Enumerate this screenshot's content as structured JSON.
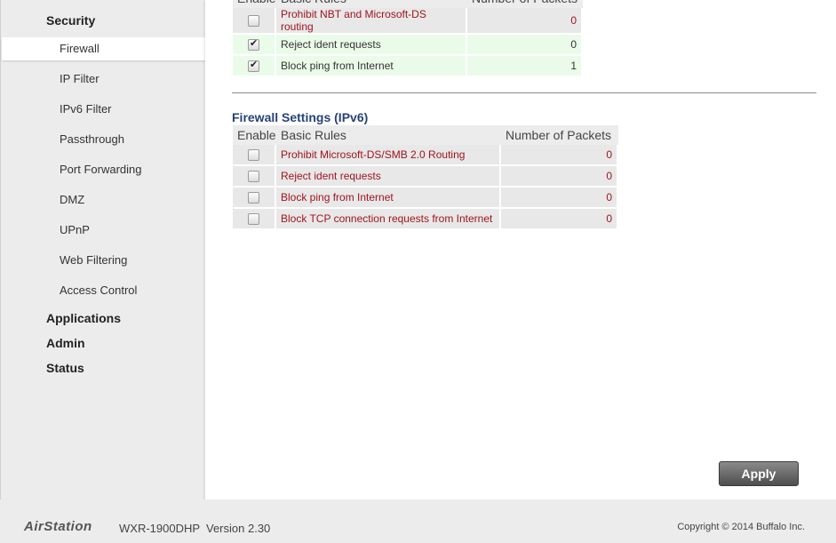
{
  "sidebar": {
    "category_security": "Security",
    "items": [
      {
        "label": "Firewall",
        "active": true
      },
      {
        "label": "IP Filter"
      },
      {
        "label": "IPv6 Filter"
      },
      {
        "label": "Passthrough"
      },
      {
        "label": "Port Forwarding"
      },
      {
        "label": "DMZ"
      },
      {
        "label": "UPnP"
      },
      {
        "label": "Web Filtering"
      },
      {
        "label": "Access Control"
      }
    ],
    "category_applications": "Applications",
    "category_admin": "Admin",
    "category_status": "Status"
  },
  "ipv4_table": {
    "headers": {
      "enable": "Enable",
      "rules": "Basic Rules",
      "packets": "Number of Packets"
    },
    "rows": [
      {
        "rule": "Prohibit NBT and Microsoft-DS routing",
        "packets": "0",
        "checked": false
      },
      {
        "rule": "Reject ident requests",
        "packets": "0",
        "checked": true
      },
      {
        "rule": "Block ping from Internet",
        "packets": "1",
        "checked": true
      }
    ]
  },
  "ipv6_section": {
    "title": "Firewall Settings (IPv6)",
    "headers": {
      "enable": "Enable",
      "rules": "Basic Rules",
      "packets": "Number of Packets"
    },
    "rows": [
      {
        "rule": "Prohibit Microsoft-DS/SMB 2.0 Routing",
        "packets": "0",
        "checked": false
      },
      {
        "rule": "Reject ident requests",
        "packets": "0",
        "checked": false
      },
      {
        "rule": "Block ping from Internet",
        "packets": "0",
        "checked": false
      },
      {
        "rule": "Block TCP connection requests from Internet",
        "packets": "0",
        "checked": false
      }
    ]
  },
  "apply_label": "Apply",
  "footer": {
    "brand": "AirStation",
    "model": "WXR-1900DHP",
    "version": "Version 2.30",
    "copyright": "Copyright © 2014 Buffalo Inc."
  },
  "colors": {
    "rule_red": "#a0141e",
    "section_blue": "#27427a",
    "enabled_row_bg": "#eafbea",
    "row_bg": "#e8e8e8"
  }
}
